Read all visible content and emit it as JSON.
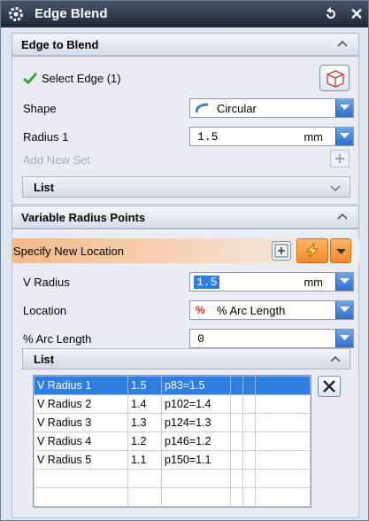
{
  "dialog": {
    "title": "Edge Blend"
  },
  "edge_to_blend": {
    "header": "Edge to Blend",
    "select_edge_label": "Select Edge (1)",
    "shape_label": "Shape",
    "shape_value": "Circular",
    "radius_label": "Radius 1",
    "radius_value": "1.5",
    "radius_unit": "mm",
    "add_new_set_label": "Add New Set",
    "list_label": "List"
  },
  "variable_radius": {
    "header": "Variable Radius Points",
    "specify_location_label": "Specify New Location",
    "v_radius_label": "V Radius",
    "v_radius_value": "1.5",
    "v_radius_unit": "mm",
    "location_label": "Location",
    "location_value": "% Arc Length",
    "location_icon_text": "%",
    "arc_length_label": "% Arc Length",
    "arc_length_value": "0",
    "list_label": "List",
    "rows": [
      {
        "name": "V Radius 1",
        "radius": "1.5",
        "param": "p83=1.5"
      },
      {
        "name": "V Radius 2",
        "radius": "1.4",
        "param": "p102=1.4"
      },
      {
        "name": "V Radius 3",
        "radius": "1.3",
        "param": "p124=1.3"
      },
      {
        "name": "V Radius 4",
        "radius": "1.2",
        "param": "p146=1.2"
      },
      {
        "name": "V Radius 5",
        "radius": "1.1",
        "param": "p150=1.1"
      }
    ]
  },
  "colors": {
    "accent": "#2e7de0",
    "titlebar": "#1e2836",
    "highlight": "#f3b98a"
  }
}
